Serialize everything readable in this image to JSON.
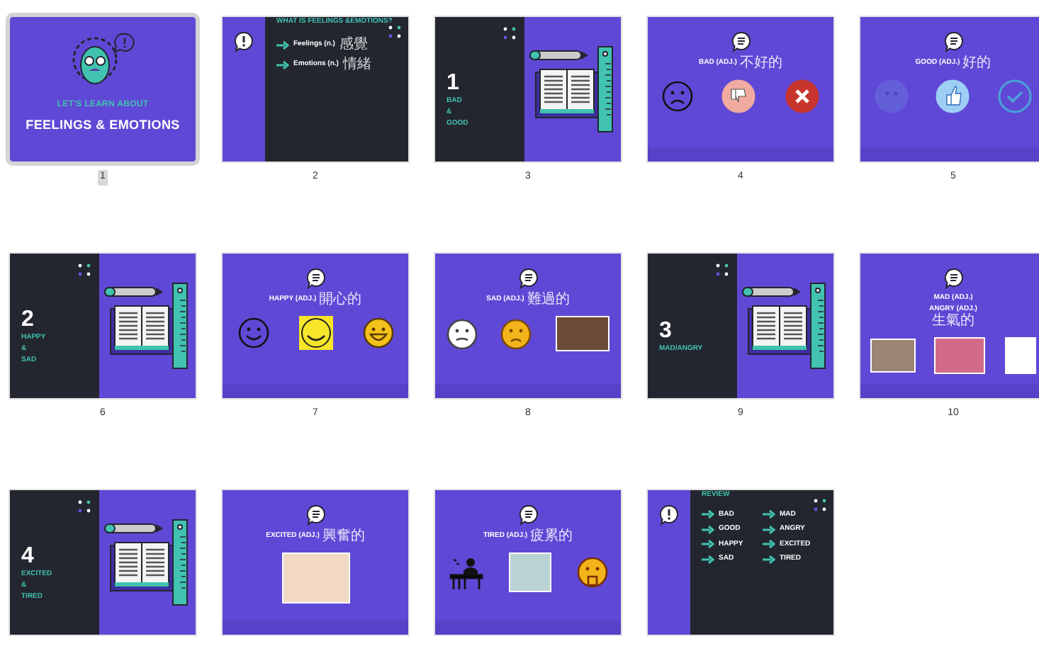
{
  "slides": [
    {
      "number": "1",
      "selected": true,
      "kind": "title",
      "subtitle": "LET'S LEARN ABOUT",
      "title": "FEELINGS & EMOTIONS"
    },
    {
      "number": "2",
      "selected": false,
      "kind": "question",
      "heading": "WHAT IS FEELINGS &EMOTIONS?",
      "items": [
        {
          "text": "Feelings (n.)",
          "zh": "感覺"
        },
        {
          "text": "Emotions (n.)",
          "zh": "情緒"
        }
      ]
    },
    {
      "number": "3",
      "selected": false,
      "kind": "section",
      "index": "1",
      "lines": [
        "BAD",
        "&",
        "GOOD"
      ]
    },
    {
      "number": "4",
      "selected": false,
      "kind": "vocab",
      "lines": [
        {
          "text": "BAD (ADJ.)",
          "zh": "不好的"
        }
      ]
    },
    {
      "number": "5",
      "selected": false,
      "kind": "vocab",
      "lines": [
        {
          "text": "GOOD (ADJ.)",
          "zh": "好的"
        }
      ]
    },
    {
      "number": "6",
      "selected": false,
      "kind": "section",
      "index": "2",
      "lines": [
        "HAPPY",
        "&",
        "SAD"
      ]
    },
    {
      "number": "7",
      "selected": false,
      "kind": "vocab",
      "lines": [
        {
          "text": "HAPPY (ADJ.)",
          "zh": "開心的"
        }
      ]
    },
    {
      "number": "8",
      "selected": false,
      "kind": "vocab",
      "lines": [
        {
          "text": "SAD (ADJ.)",
          "zh": "難過的"
        }
      ]
    },
    {
      "number": "9",
      "selected": false,
      "kind": "section",
      "index": "3",
      "lines": [
        "MAD/ANGRY"
      ]
    },
    {
      "number": "10",
      "selected": false,
      "kind": "vocab",
      "lines": [
        {
          "text": "MAD (ADJ.)"
        },
        {
          "text": "ANGRY (ADJ.)"
        },
        {
          "zh": "生氣的"
        }
      ]
    },
    {
      "selected": false,
      "kind": "section",
      "index": "4",
      "lines": [
        "EXCITED",
        "&",
        "TIRED"
      ]
    },
    {
      "selected": false,
      "kind": "vocab",
      "lines": [
        {
          "text": "EXCITED (ADJ.)",
          "zh": "興奮的"
        }
      ]
    },
    {
      "selected": false,
      "kind": "vocab",
      "lines": [
        {
          "text": "TIRED (ADJ.)",
          "zh": "疲累的"
        }
      ]
    },
    {
      "selected": false,
      "kind": "review",
      "heading": "REVIEW",
      "items": [
        "BAD",
        "GOOD",
        "HAPPY",
        "SAD",
        "MAD",
        "ANGRY",
        "EXCITED",
        "TIRED"
      ]
    }
  ]
}
